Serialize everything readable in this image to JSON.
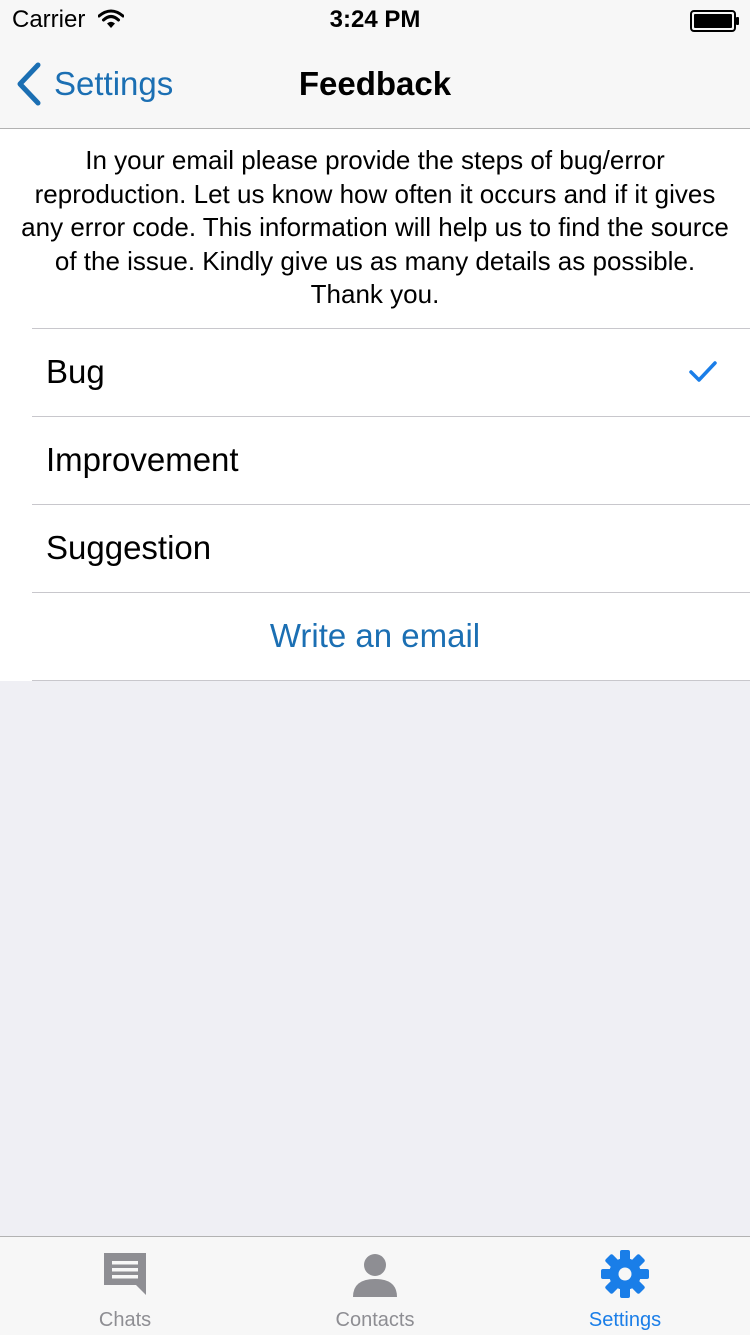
{
  "status_bar": {
    "carrier": "Carrier",
    "time": "3:24 PM",
    "icons": [
      "wifi-icon",
      "battery-icon"
    ]
  },
  "nav": {
    "back_label": "Settings",
    "title": "Feedback"
  },
  "info_text": "In your email please provide the steps of bug/error reproduction. Let us know how often it occurs and if it gives any error code. This information will help us to find the source of the issue. Kindly give us as many details as possible. Thank you.",
  "feedback_types": [
    {
      "label": "Bug",
      "selected": true
    },
    {
      "label": "Improvement",
      "selected": false
    },
    {
      "label": "Suggestion",
      "selected": false
    }
  ],
  "action": {
    "label": "Write an email"
  },
  "tab_bar": {
    "tabs": [
      {
        "label": "Chats",
        "icon": "chat-bubble-icon",
        "active": false
      },
      {
        "label": "Contacts",
        "icon": "person-icon",
        "active": false
      },
      {
        "label": "Settings",
        "icon": "gear-icon",
        "active": true
      }
    ]
  },
  "colors": {
    "accent": "#1b6fb3",
    "checkmark": "#1a7ee8",
    "inactive_tab": "#8e8e93",
    "background": "#efeff4"
  }
}
